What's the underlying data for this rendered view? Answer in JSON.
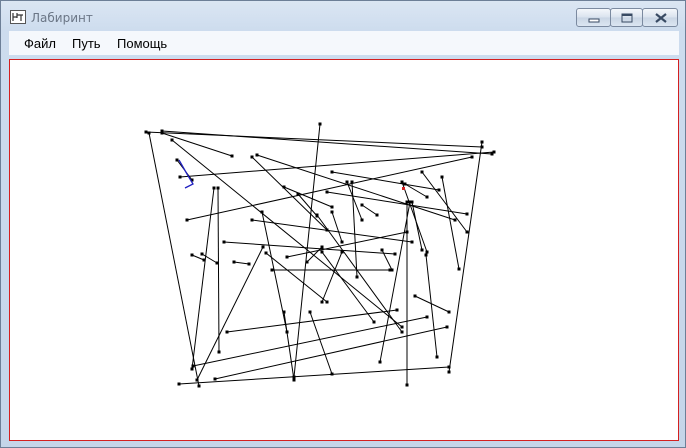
{
  "window": {
    "title": "Лабиринт"
  },
  "menu": {
    "file": "Файл",
    "path": "Путь",
    "help": "Помощь"
  },
  "controls": {
    "minimize_icon": "minimize-icon",
    "maximize_icon": "maximize-icon",
    "close_icon": "close-icon"
  },
  "colors": {
    "canvas_border": "#d42020",
    "maze_lines": "#000000",
    "path": "#2020c0",
    "goal_marker": "#d42020"
  }
}
